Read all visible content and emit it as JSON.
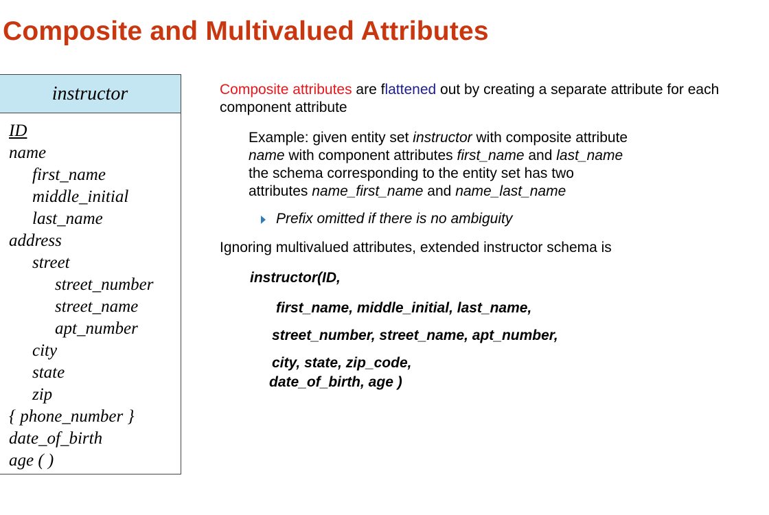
{
  "slide": {
    "title": "Composite and Multivalued Attributes",
    "title_color": "#c8370f"
  },
  "entity": {
    "name": "instructor",
    "header_color": "#c3e6f2",
    "attributes": [
      {
        "text": "ID",
        "level": 0,
        "primary_key": true
      },
      {
        "text": "name",
        "level": 0
      },
      {
        "text": "first_name",
        "level": 1
      },
      {
        "text": "middle_initial",
        "level": 1
      },
      {
        "text": "last_name",
        "level": 1
      },
      {
        "text": "address",
        "level": 0
      },
      {
        "text": "street",
        "level": 1
      },
      {
        "text": "street_number",
        "level": 2
      },
      {
        "text": "street_name",
        "level": 2
      },
      {
        "text": "apt_number",
        "level": 2
      },
      {
        "text": "city",
        "level": 1
      },
      {
        "text": "state",
        "level": 1
      },
      {
        "text": "zip",
        "level": 1
      },
      {
        "text": "{ phone_number }",
        "level": 0
      },
      {
        "text": "date_of_birth",
        "level": 0
      },
      {
        "text": "age ( )",
        "level": 0
      }
    ]
  },
  "content": {
    "p1": {
      "red": "Composite attributes",
      "middle": " are f",
      "blue": "lattened",
      "rest": " out by creating a separate attribute for each component attribute"
    },
    "example": {
      "t1": "Example: given entity set ",
      "i1": "instructor",
      "t2": " with composite attribute ",
      "i2": "name",
      "t3": " with component attributes ",
      "i3": "first_name",
      "t4": " and ",
      "i4": "last_name",
      "t5": " the schema corresponding to the entity set has two attributes ",
      "i5": "name_first_name",
      "t6": "  and ",
      "i6": "name_last_name"
    },
    "bullet": "Prefix omitted if there is no ambiguity",
    "p2": "Ignoring multivalued attributes, extended instructor schema is",
    "schema_lines": [
      "instructor(ID,",
      "first_name, middle_initial,  last_name,",
      "street_number, street_name,  apt_number,",
      "city, state, zip_code,",
      "date_of_birth, age )"
    ],
    "colors": {
      "red": "#e8161b",
      "blue": "#1c1c8c",
      "bullet_arrow": "#2f7fb8"
    }
  }
}
